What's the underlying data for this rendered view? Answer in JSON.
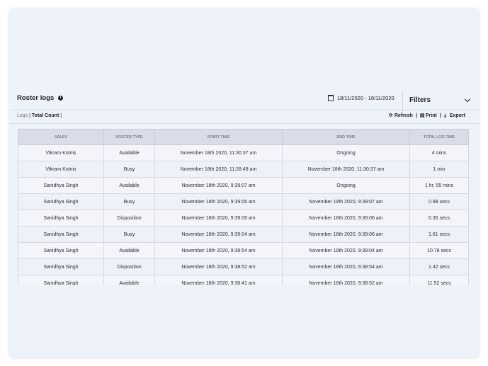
{
  "header": {
    "title": "Roster logs",
    "date_range": "18/11/2020 - 18/11/2020",
    "filters_label": "Filters"
  },
  "subbar": {
    "logs_label": "Logs",
    "separator": "|",
    "total_label": "Total Count",
    "refresh_label": "Refresh",
    "print_label": "Print",
    "export_label": "Export"
  },
  "table": {
    "columns": [
      "SALES",
      "ROSTER TYPE",
      "START TIME",
      "END TIME",
      "TOTAL LOG TIME"
    ],
    "rows": [
      [
        "Vikram Kotnis",
        "Available",
        "November 18th 2020, 11:30:37 am",
        "Ongoing",
        "4 mins"
      ],
      [
        "Vikram Kotnis",
        "Busy",
        "November 18th 2020, 11:28:49 am",
        "November 18th 2020, 11:30:37 am",
        "1 min"
      ],
      [
        "Sanidhya Singh",
        "Available",
        "November 18th 2020, 9:39:07 am",
        "Ongoing",
        "1 hr, 55 mins"
      ],
      [
        "Sanidhya Singh",
        "Busy",
        "November 18th 2020, 9:39:06 am",
        "November 18th 2020, 9:39:07 am",
        "0.98 secs"
      ],
      [
        "Sanidhya Singh",
        "Disposition",
        "November 18th 2020, 9:39:06 am",
        "November 18th 2020, 9:39:06 am",
        "0.35 secs"
      ],
      [
        "Sanidhya Singh",
        "Busy",
        "November 18th 2020, 9:39:04 am",
        "November 18th 2020, 9:39:06 am",
        "1.61 secs"
      ],
      [
        "Sanidhya Singh",
        "Available",
        "November 18th 2020, 9:38:54 am",
        "November 18th 2020, 9:39:04 am",
        "10.78 secs"
      ],
      [
        "Sanidhya Singh",
        "Disposition",
        "November 18th 2020, 9:38:52 am",
        "November 18th 2020, 9:38:54 am",
        "1.42 secs"
      ],
      [
        "Sanidhya Singh",
        "Available",
        "November 18th 2020, 9:38:41 am",
        "November 18th 2020, 9:38:52 am",
        "11.52 secs"
      ]
    ]
  },
  "icons": {
    "info": "info-icon",
    "calendar": "calendar-icon",
    "filters": "chevron-down-icon",
    "refresh": "refresh-icon",
    "print": "print-icon",
    "export": "export-icon"
  },
  "colors": {
    "panel_bg": "#eef2fb",
    "table_header_bg": "#d8dde8",
    "text": "#2b2f38"
  }
}
